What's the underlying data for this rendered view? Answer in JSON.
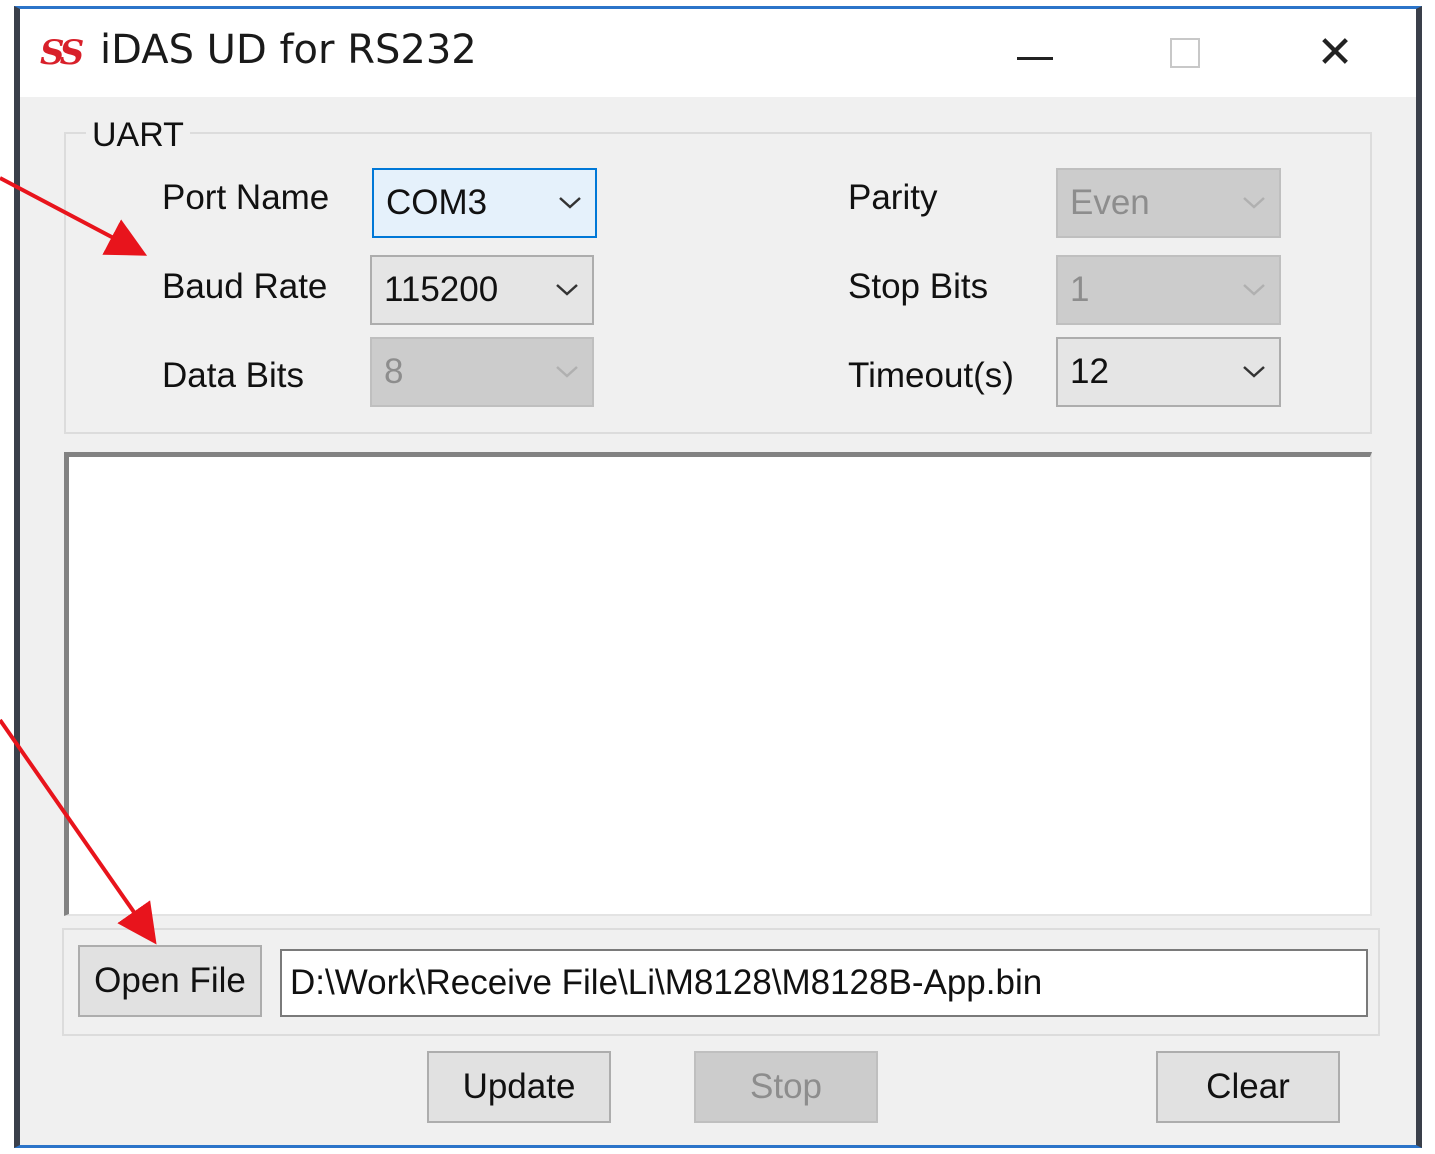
{
  "window": {
    "logo_text": "SS",
    "title": "iDAS UD for RS232",
    "controls": {
      "minimize": "minimize-icon",
      "maximize": "maximize-icon",
      "close": "close-icon"
    },
    "close_glyph": "✕"
  },
  "uart": {
    "legend": "UART",
    "port_name": {
      "label": "Port Name",
      "value": "COM3",
      "state": "focused"
    },
    "baud_rate": {
      "label": "Baud Rate",
      "value": "115200",
      "state": "enabled"
    },
    "data_bits": {
      "label": "Data Bits",
      "value": "8",
      "state": "disabled"
    },
    "parity": {
      "label": "Parity",
      "value": "Even",
      "state": "disabled"
    },
    "stop_bits": {
      "label": "Stop Bits",
      "value": "1",
      "state": "disabled"
    },
    "timeout": {
      "label": "Timeout(s)",
      "value": "12",
      "state": "enabled"
    }
  },
  "log": {
    "text": ""
  },
  "file": {
    "open_button": "Open File",
    "path": "D:\\Work\\Receive File\\Li\\M8128\\M8128B-App.bin"
  },
  "actions": {
    "update": {
      "label": "Update",
      "state": "enabled"
    },
    "stop": {
      "label": "Stop",
      "state": "disabled"
    },
    "clear": {
      "label": "Clear",
      "state": "enabled"
    }
  },
  "colors": {
    "accent": "#0078d7",
    "logo": "#d8202a",
    "annotation_arrow": "#e8141c",
    "window_border": "#2b74c9"
  }
}
